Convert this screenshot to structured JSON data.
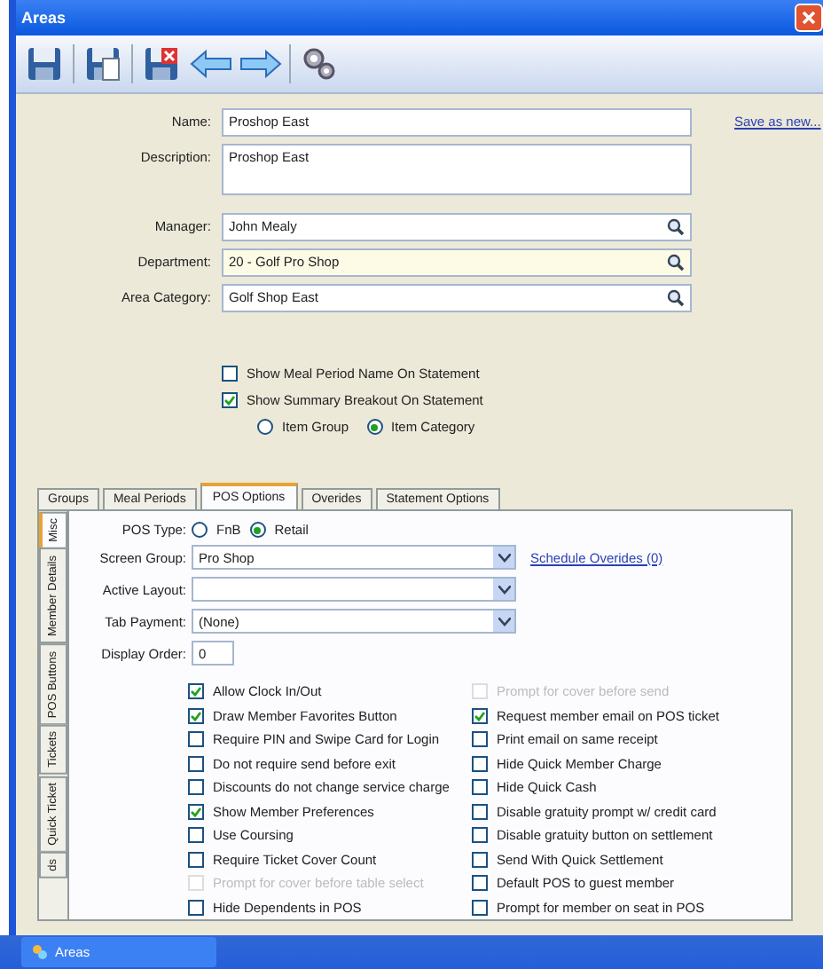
{
  "window": {
    "title": "Areas"
  },
  "form": {
    "fields": [
      {
        "label": "Name:",
        "value": "Proshop East",
        "kind": "text",
        "focused": false
      },
      {
        "label": "Description:",
        "value": "Proshop East",
        "kind": "multiline",
        "focused": false
      },
      {
        "label": "Manager:",
        "value": "John Mealy",
        "kind": "lookup",
        "focused": false
      },
      {
        "label": "Department:",
        "value": "20 - Golf Pro Shop",
        "kind": "lookup",
        "focused": true
      },
      {
        "label": "Area Category:",
        "value": "Golf Shop East",
        "kind": "lookup",
        "focused": false
      }
    ],
    "save_link": "Save as new...",
    "checkboxes": [
      {
        "label": "Show Meal Period Name On Statement",
        "checked": false
      },
      {
        "label": "Show Summary Breakout On Statement",
        "checked": true
      }
    ],
    "radios": [
      {
        "label": "Item Group",
        "selected": false
      },
      {
        "label": "Item Category",
        "selected": true
      }
    ]
  },
  "tabs": [
    {
      "label": "Groups",
      "selected": false
    },
    {
      "label": "Meal Periods",
      "selected": false
    },
    {
      "label": "POS Options",
      "selected": true
    },
    {
      "label": "Overides",
      "selected": false
    },
    {
      "label": "Statement Options",
      "selected": false
    }
  ],
  "side_tabs": [
    {
      "label": "Misc",
      "selected": true
    },
    {
      "label": "Member Details",
      "selected": false
    },
    {
      "label": "POS Buttons",
      "selected": false
    },
    {
      "label": "Tickets",
      "selected": false
    },
    {
      "label": "Quick Ticket",
      "selected": false
    },
    {
      "label": "ds",
      "selected": false
    }
  ],
  "pos": {
    "type_label": "POS Type:",
    "types": [
      {
        "label": "FnB",
        "selected": false
      },
      {
        "label": "Retail",
        "selected": true
      }
    ],
    "fields": [
      {
        "label": "Screen Group:",
        "value": "Pro Shop",
        "kind": "dropdown"
      },
      {
        "label": "Active Layout:",
        "kind": "dropdown"
      },
      {
        "label": "Tab Payment:",
        "value": "(None)",
        "kind": "dropdown"
      },
      {
        "label": "Display Order:",
        "value": "0",
        "kind": "number"
      }
    ],
    "schedule_link": "Schedule Overides (0)",
    "left_options": [
      {
        "label": "Allow Clock In/Out",
        "checked": true,
        "disabled": false
      },
      {
        "label": "Draw Member Favorites Button",
        "checked": true,
        "disabled": false
      },
      {
        "label": "Require PIN and Swipe Card for Login",
        "checked": false,
        "disabled": false
      },
      {
        "label": "Do not require send before exit",
        "checked": false,
        "disabled": false
      },
      {
        "label": "Discounts do not change service charge",
        "checked": false,
        "disabled": false
      },
      {
        "label": "Show Member Preferences",
        "checked": true,
        "disabled": false
      },
      {
        "label": "Use Coursing",
        "checked": false,
        "disabled": false
      },
      {
        "label": "Require Ticket Cover Count",
        "checked": false,
        "disabled": false
      },
      {
        "label": "Prompt for cover before table select",
        "checked": false,
        "disabled": true
      },
      {
        "label": "Hide Dependents in POS",
        "checked": false,
        "disabled": false
      }
    ],
    "right_options": [
      {
        "label": "Prompt for cover before send",
        "checked": false,
        "disabled": true
      },
      {
        "label": "Request member email on POS ticket",
        "checked": true,
        "disabled": false
      },
      {
        "label": "Print email on same receipt",
        "checked": false,
        "disabled": false
      },
      {
        "label": "Hide Quick Member Charge",
        "checked": false,
        "disabled": false
      },
      {
        "label": "Hide Quick Cash",
        "checked": false,
        "disabled": false
      },
      {
        "label": "Disable gratuity prompt w/ credit card",
        "checked": false,
        "disabled": false
      },
      {
        "label": "Disable gratuity button on settlement",
        "checked": false,
        "disabled": false
      },
      {
        "label": "Send With Quick Settlement",
        "checked": false,
        "disabled": false
      },
      {
        "label": "Default POS to guest member",
        "checked": false,
        "disabled": false
      },
      {
        "label": "Prompt for member on seat in POS",
        "checked": false,
        "disabled": false
      }
    ]
  },
  "taskbar": {
    "items": [
      {
        "label": "Areas"
      }
    ]
  }
}
